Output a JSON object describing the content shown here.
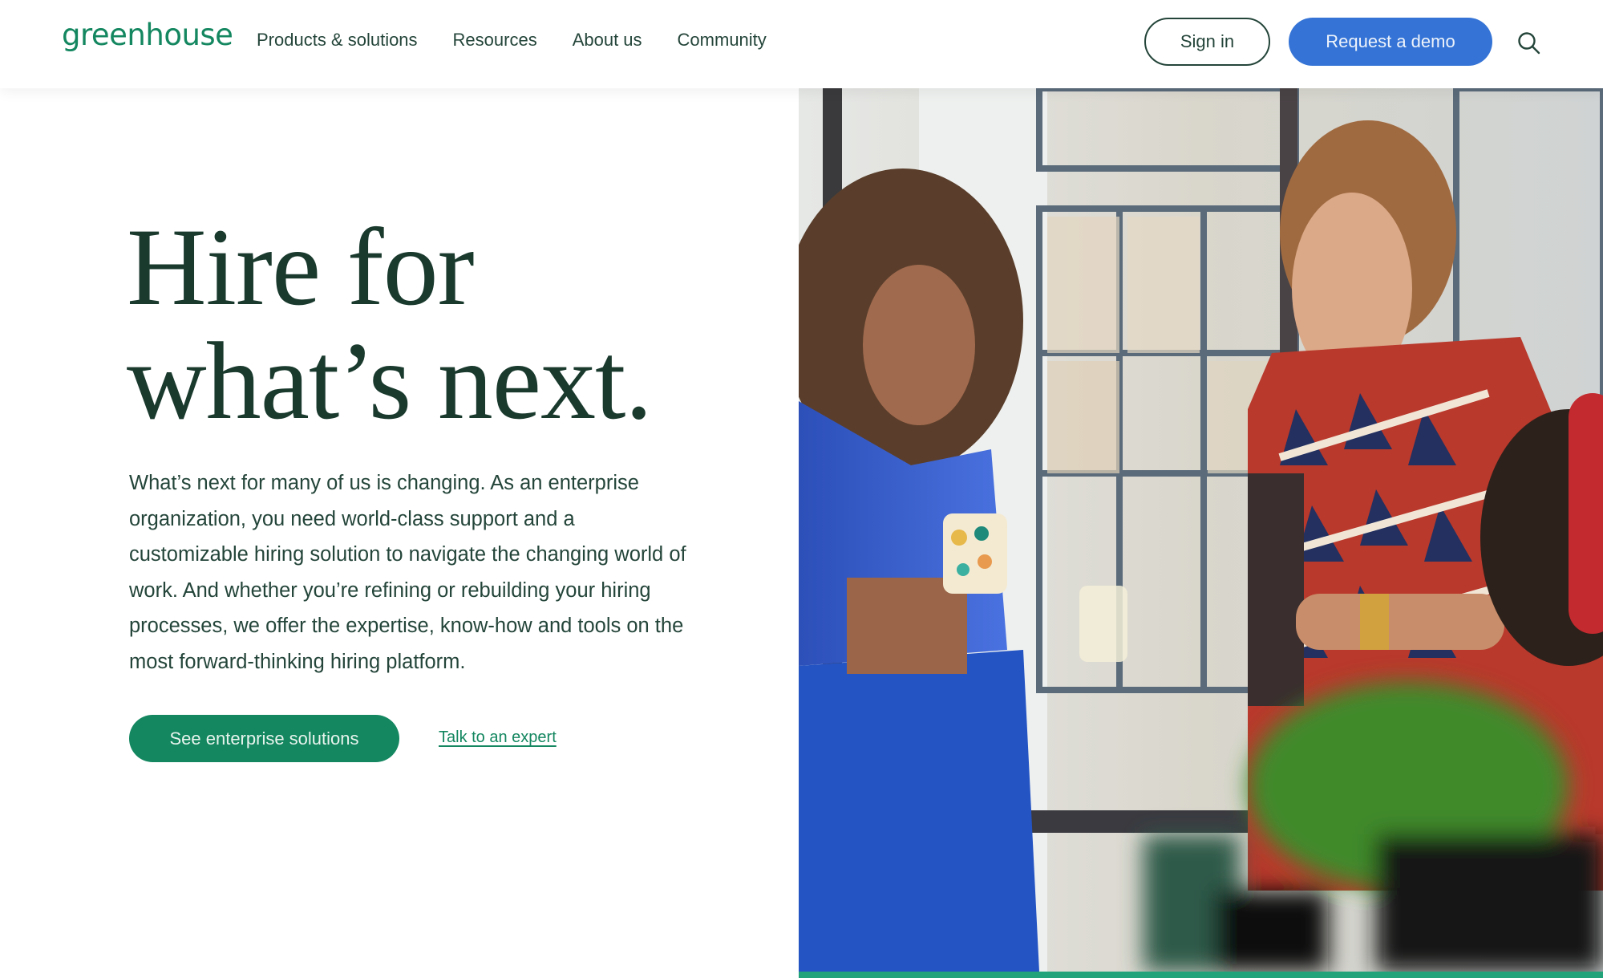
{
  "header": {
    "logo": "greenhouse",
    "nav": [
      {
        "label": "Products & solutions"
      },
      {
        "label": "Resources"
      },
      {
        "label": "About us"
      },
      {
        "label": "Community"
      }
    ],
    "sign_in_label": "Sign in",
    "demo_label": "Request a demo",
    "search_icon": "search-icon"
  },
  "hero": {
    "headline_line1": "Hire for",
    "headline_line2": "what’s next.",
    "body": "What’s next for many of us is changing. As an enterprise organization, you need world-class support and a customizable hiring solution to navigate the changing world of work. And whether you’re refining or rebuilding your hiring processes, we offer the expertise, know-how and tools on the most forward-thinking hiring platform.",
    "primary_cta": "See enterprise solutions",
    "secondary_cta": "Talk to an expert",
    "image_alt": "Coworkers chatting by an office window holding coffee mugs"
  },
  "colors": {
    "brand_green": "#148760",
    "dark_green_text": "#1a3a2e",
    "demo_blue": "#3574d6",
    "accent_bar": "#22a37a"
  }
}
